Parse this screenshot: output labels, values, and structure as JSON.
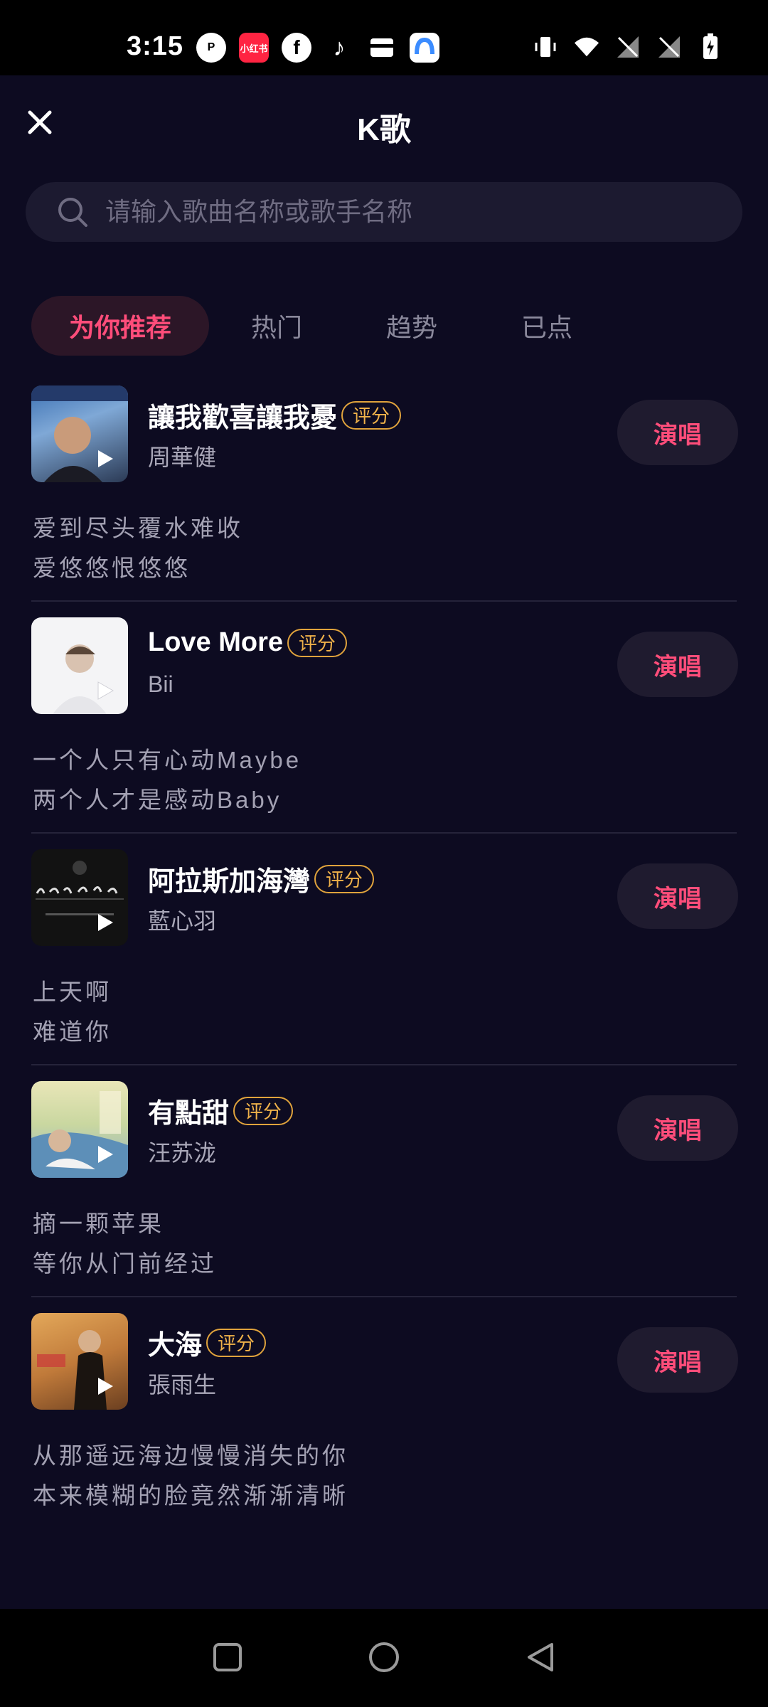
{
  "status_bar": {
    "time": "3:15",
    "apps": [
      {
        "name": "p-app-icon",
        "label": "P",
        "color": "#ffffff"
      },
      {
        "name": "xiaohongshu-icon",
        "label": "小红书",
        "color": "#ff2442"
      },
      {
        "name": "facebook-icon",
        "label": "f",
        "color": "#ffffff"
      },
      {
        "name": "tiktok-icon",
        "label": "♪",
        "color": "#ffffff"
      },
      {
        "name": "wallet-icon",
        "label": "",
        "color": "#ffffff"
      },
      {
        "name": "blue-app-icon",
        "label": "",
        "color": "#3b8cff"
      }
    ]
  },
  "header": {
    "title": "K歌"
  },
  "search": {
    "placeholder": "请输入歌曲名称或歌手名称"
  },
  "tabs": [
    {
      "label": "为你推荐",
      "active": true
    },
    {
      "label": "热门",
      "active": false
    },
    {
      "label": "趋势",
      "active": false
    },
    {
      "label": "已点",
      "active": false
    }
  ],
  "songs": [
    {
      "title": "讓我歡喜讓我憂",
      "badge": "评分",
      "artist": "周華健",
      "action": "演唱",
      "lyrics": [
        "爱到尽头覆水难收",
        "爱悠悠恨悠悠"
      ]
    },
    {
      "title": "Love More",
      "badge": "评分",
      "artist": "Bii",
      "action": "演唱",
      "lyrics": [
        "一个人只有心动Maybe",
        "两个人才是感动Baby"
      ]
    },
    {
      "title": "阿拉斯加海灣",
      "badge": "评分",
      "artist": "藍心羽",
      "action": "演唱",
      "lyrics": [
        "上天啊",
        "难道你"
      ]
    },
    {
      "title": "有點甜",
      "badge": "评分",
      "artist": "汪苏泷",
      "action": "演唱",
      "lyrics": [
        "摘一颗苹果",
        "等你从门前经过"
      ]
    },
    {
      "title": "大海",
      "badge": "评分",
      "artist": "張雨生",
      "action": "演唱",
      "lyrics": [
        "从那遥远海边慢慢消失的你",
        "本来模糊的脸竟然渐渐清晰"
      ]
    }
  ],
  "colors": {
    "background": "#0d0b21",
    "accent": "#ff4d7a",
    "badge": "#f0b24a"
  }
}
